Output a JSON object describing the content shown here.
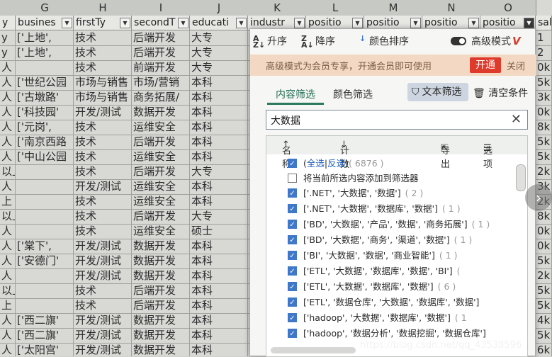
{
  "columns": {
    "letters": [
      "G",
      "H",
      "I",
      "J",
      "K",
      "L",
      "M",
      "N",
      "O"
    ],
    "headers": [
      "busines",
      "firstTy",
      "secondT",
      "educati",
      "industr",
      "positio",
      "positio",
      "positio",
      "positio"
    ],
    "right_header": "sal"
  },
  "rows": [
    {
      "a": "y",
      "g": "['上地',",
      "h": "技术",
      "i": "后端开发",
      "j": "大专",
      "k": "企",
      "r": "1"
    },
    {
      "a": "y",
      "g": "['上地',",
      "h": "技术",
      "i": "后端开发",
      "j": "大专",
      "k": "",
      "r": "2"
    },
    {
      "a": "人",
      "g": "",
      "h": "技术",
      "i": "前端开发",
      "j": "大专",
      "k": "",
      "r": "0k"
    },
    {
      "a": "人",
      "g": "['世纪公园",
      "h": "市场与销售",
      "i": "市场/营销",
      "j": "本科",
      "k": "",
      "r": "5k"
    },
    {
      "a": "人",
      "g": "['古墩路'",
      "h": "市场与销售",
      "i": "商务拓展/",
      "j": "本科",
      "k": "",
      "r": "3k"
    },
    {
      "a": "人",
      "g": "['科技园'",
      "h": "开发/测试",
      "i": "数据开发",
      "j": "本科",
      "k": "和",
      "r": "0k"
    },
    {
      "a": "人",
      "g": "['元岗',",
      "h": "技术",
      "i": "运维安全",
      "j": "本科",
      "k": "和",
      "r": "8k"
    },
    {
      "a": "人",
      "g": "['南京西路",
      "h": "技术",
      "i": "后端开发",
      "j": "本科",
      "k": "和",
      "r": "5k"
    },
    {
      "a": "人",
      "g": "['中山公园",
      "h": "技术",
      "i": "运维安全",
      "j": "本科",
      "k": "和",
      "r": "5k"
    },
    {
      "a": "以上",
      "g": "",
      "h": "技术",
      "i": "后端开发",
      "j": "大专",
      "k": "和",
      "r": "2k"
    },
    {
      "a": "人",
      "g": "",
      "h": "开发/测试",
      "i": "运维安全",
      "j": "本科",
      "k": "和",
      "r": "3k"
    },
    {
      "a": "上",
      "g": "",
      "h": "技术",
      "i": "运维安全",
      "j": "本科",
      "k": "申",
      "r": "2k"
    },
    {
      "a": "以上",
      "g": "",
      "h": "技术",
      "i": "后端开发",
      "j": "大专",
      "k": "和",
      "r": "8k"
    },
    {
      "a": "人",
      "g": "",
      "h": "技术",
      "i": "运维安全",
      "j": "硕士",
      "k": "和",
      "r": "0k"
    },
    {
      "a": "人",
      "g": "['棠下',",
      "h": "开发/测试",
      "i": "数据开发",
      "j": "本科",
      "k": "数",
      "r": "0k"
    },
    {
      "a": "人",
      "g": "['安德门'",
      "h": "开发/测试",
      "i": "数据开发",
      "j": "本科",
      "k": "和",
      "r": "5k"
    },
    {
      "a": "人",
      "g": "",
      "h": "开发/测试",
      "i": "数据开发",
      "j": "本科",
      "k": "企",
      "r": "2k"
    },
    {
      "a": "以上",
      "g": "",
      "h": "技术",
      "i": "后端开发",
      "j": "本科",
      "k": "数",
      "r": "5k"
    },
    {
      "a": "上",
      "g": "",
      "h": "技术",
      "i": "后端开发",
      "j": "本科",
      "k": "和",
      "r": "5k"
    },
    {
      "a": "人",
      "g": "['西二旗'",
      "h": "开发/测试",
      "i": "数据开发",
      "j": "本科",
      "k": "和",
      "r": "4k"
    },
    {
      "a": "人",
      "g": "['西二旗'",
      "h": "开发/测试",
      "i": "数据开发",
      "j": "本科",
      "k": "和",
      "r": "5k"
    },
    {
      "a": "人",
      "g": "['太阳宫'",
      "h": "开发/测试",
      "i": "数据开发",
      "j": "本科",
      "k": "和",
      "r": "6k"
    },
    {
      "a": "人",
      "g": "['西北旺'",
      "h": "开发/测试",
      "i": "数据开发",
      "j": "硕士",
      "k": "",
      "r": "9k"
    }
  ],
  "popup": {
    "sort_asc": "升序",
    "sort_desc": "降序",
    "sort_color": "颜色排序",
    "advanced_mode": "高级模式",
    "advanced_logo": "V",
    "vip_notice": "高级模式为会员专享，开通会员即可使用",
    "open_btn": "开通",
    "close_btn": "关闭",
    "tab_content": "内容筛选",
    "tab_color": "颜色筛选",
    "text_filter": "文本筛选",
    "clear_conditions": "清空条件",
    "search_value": "大数据",
    "list_head": {
      "name": "名称",
      "count": "计数",
      "export": "导出",
      "options": "选项"
    },
    "select_all": "全选",
    "invert": "反选",
    "select_all_count": "( 6876 )",
    "add_to_filter": "将当前所选内容添加到筛选器",
    "items": [
      {
        "text": "['.NET', '大数据', '数据']",
        "count": "( 2 )"
      },
      {
        "text": "['.NET', '大数据', '数据库', '数据']",
        "count": "( 1 )"
      },
      {
        "text": "['BD', '大数据', '产品', '数据', '商务拓展']",
        "count": "( 1 )"
      },
      {
        "text": "['BD', '大数据', '商务', '渠道', '数据']",
        "count": "( 1 )"
      },
      {
        "text": "['BI', '大数据', '数据', '商业智能']",
        "count": "( 1 )"
      },
      {
        "text": "['ETL', '大数据', '数据库', '数据', 'BI']",
        "count": "("
      },
      {
        "text": "['ETL', '大数据', '数据库', '数据']",
        "count": "( 6 )"
      },
      {
        "text": "['ETL', '数据仓库', '大数据', '数据库', '数据']",
        "count": ""
      },
      {
        "text": "['hadoop', '大数据', '数据库', '数据']",
        "count": "( 1"
      },
      {
        "text": "['hadoop', '数据分析', '数据挖掘', '数据仓库']",
        "count": ""
      }
    ]
  },
  "watermark": "https://blog.csdn.net/qq_43538596",
  "colors": {
    "accent_red": "#de3b2c",
    "checkbox_blue": "#3f78c8",
    "tab_green": "#2a7a5e"
  }
}
